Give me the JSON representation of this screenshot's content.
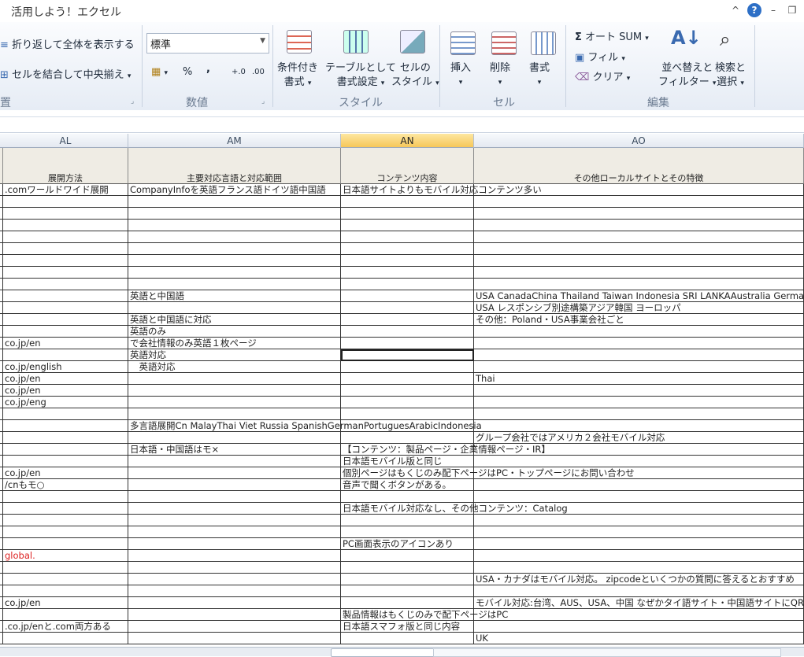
{
  "window": {
    "title": "活用しよう！エクセル",
    "controls": [
      "^",
      "?",
      "–",
      "❐"
    ]
  },
  "ribbon": {
    "wrap_text": "折り返して全体を表示する",
    "merge_center": "セルを結合して中央揃え",
    "alignment_group_fragment": "置",
    "number_format": "標準",
    "percent": "%",
    "comma": ",",
    "increase_decimal": "+.0",
    "decrease_decimal": ".00",
    "number_group": "数値",
    "conditional_format": [
      "条件付き",
      "書式"
    ],
    "format_as_table": [
      "テーブルとして",
      "書式設定"
    ],
    "cell_styles": [
      "セルの",
      "スタイル"
    ],
    "styles_group": "スタイル",
    "insert": "挿入",
    "delete": "削除",
    "format": "書式",
    "cells_group": "セル",
    "autosum": "オート SUM",
    "fill": "フィル",
    "clear": "クリア",
    "sort_filter": [
      "並べ替えと",
      "フィルター"
    ],
    "find_select": [
      "検索と",
      "選択"
    ],
    "editing_group": "編集",
    "sigma": "Σ"
  },
  "columns": [
    {
      "letter": "AL",
      "header": "展開方法"
    },
    {
      "letter": "AM",
      "header": "主要対応言語と対応範囲"
    },
    {
      "letter": "AN",
      "header": "コンテンツ内容"
    },
    {
      "letter": "AO",
      "header": "その他ローカルサイトとその特徴"
    }
  ],
  "selected_column": "AN",
  "rows": [
    [
      ".comワールドワイド展開",
      "CompanyInfoを英語フランス語ドイツ語中国語",
      "日本語サイトよりもモバイル対応コンテンツ多い",
      ""
    ],
    [
      "",
      "",
      "",
      ""
    ],
    [
      "",
      "",
      "",
      ""
    ],
    [
      "",
      "",
      "",
      ""
    ],
    [
      "",
      "",
      "",
      ""
    ],
    [
      "",
      "",
      "",
      ""
    ],
    [
      "",
      "",
      "",
      ""
    ],
    [
      "",
      "",
      "",
      ""
    ],
    [
      "",
      "",
      "",
      ""
    ],
    [
      "",
      "英語と中国語",
      "",
      "USA CanadaChina Thailand Taiwan Indonesia SRI LANKAAustralia German"
    ],
    [
      "",
      "",
      "",
      "USA レスポンシブ別途構築アジア韓国 ヨーロッパ"
    ],
    [
      "",
      "英語と中国語に対応",
      "",
      "その他：Poland・USA事業会社ごと"
    ],
    [
      "",
      "英語のみ",
      "",
      ""
    ],
    [
      "co.jp/en",
      "で会社情報のみ英語１枚ページ",
      "",
      ""
    ],
    [
      "",
      "英語対応",
      "",
      ""
    ],
    [
      "co.jp/english",
      "　英語対応",
      "",
      ""
    ],
    [
      "co.jp/en",
      "",
      "",
      "Thai"
    ],
    [
      "co.jp/en",
      "",
      "",
      ""
    ],
    [
      "co.jp/eng",
      "",
      "",
      ""
    ],
    [
      "",
      "",
      "",
      ""
    ],
    [
      "",
      "多言語展開Cn MalayThai Viet Russia SpanishGermanPortuguesArabicIndonesia",
      "",
      ""
    ],
    [
      "",
      "",
      "",
      "グループ会社ではアメリカ２会社モバイル対応"
    ],
    [
      "",
      "日本語・中国語はモ×",
      "【コンテンツ：製品ページ・企業情報ページ・IR】",
      ""
    ],
    [
      "",
      "",
      "日本語モバイル版と同じ",
      ""
    ],
    [
      "co.jp/en",
      "",
      "個別ページはもくじのみ配下ページはPC・トップページにお問い合わせ",
      ""
    ],
    [
      "/cnもモ○",
      "",
      "音声で聞くボタンがある。",
      ""
    ],
    [
      "",
      "",
      "",
      ""
    ],
    [
      "",
      "",
      "日本語モバイル対応なし、その他コンテンツ：Catalog",
      ""
    ],
    [
      "",
      "",
      "",
      ""
    ],
    [
      "",
      "",
      "",
      ""
    ],
    [
      "",
      "",
      "PC画面表示のアイコンあり",
      ""
    ],
    [
      "global.",
      "",
      "",
      ""
    ],
    [
      "",
      "",
      "",
      ""
    ],
    [
      "",
      "",
      "",
      "USA・カナダはモバイル対応。 zipcodeといくつかの質問に答えるとおすすめ"
    ],
    [
      "",
      "",
      "",
      ""
    ],
    [
      "co.jp/en",
      "",
      "",
      "モバイル対応:台湾、AUS、USA、中国  なぜかタイ語サイト・中国語サイトにQRコー"
    ],
    [
      "",
      "",
      "製品情報はもくじのみで配下ページはPC",
      ""
    ],
    [
      ".co.jp/enと.com両方ある",
      "",
      "日本語スマフォ版と同じ内容",
      ""
    ],
    [
      "",
      "",
      "",
      "UK"
    ]
  ],
  "red_cells": [
    "31-0"
  ],
  "active_cell": "14-2",
  "colors": {
    "selected_header": "#f7c75a",
    "header_fill": "#efece4",
    "red_text": "#dd2222"
  }
}
